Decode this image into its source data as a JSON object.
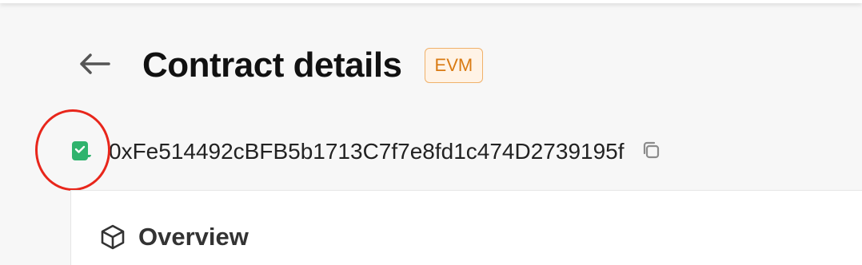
{
  "header": {
    "title": "Contract details",
    "badge": "EVM",
    "back_icon": "arrow-left-icon"
  },
  "contract": {
    "status_icon": "verified-contract-icon",
    "address": "0xFe514492cBFB5b1713C7f7e8fd1c474D2739195f",
    "copy_icon": "copy-icon"
  },
  "overview": {
    "icon": "cube-icon",
    "title": "Overview"
  },
  "colors": {
    "badge_text": "#d97a12",
    "badge_border": "#f0b16a",
    "badge_bg": "#fff3e6",
    "verified_green": "#2fb36d",
    "annotation_red": "#e8261b"
  }
}
